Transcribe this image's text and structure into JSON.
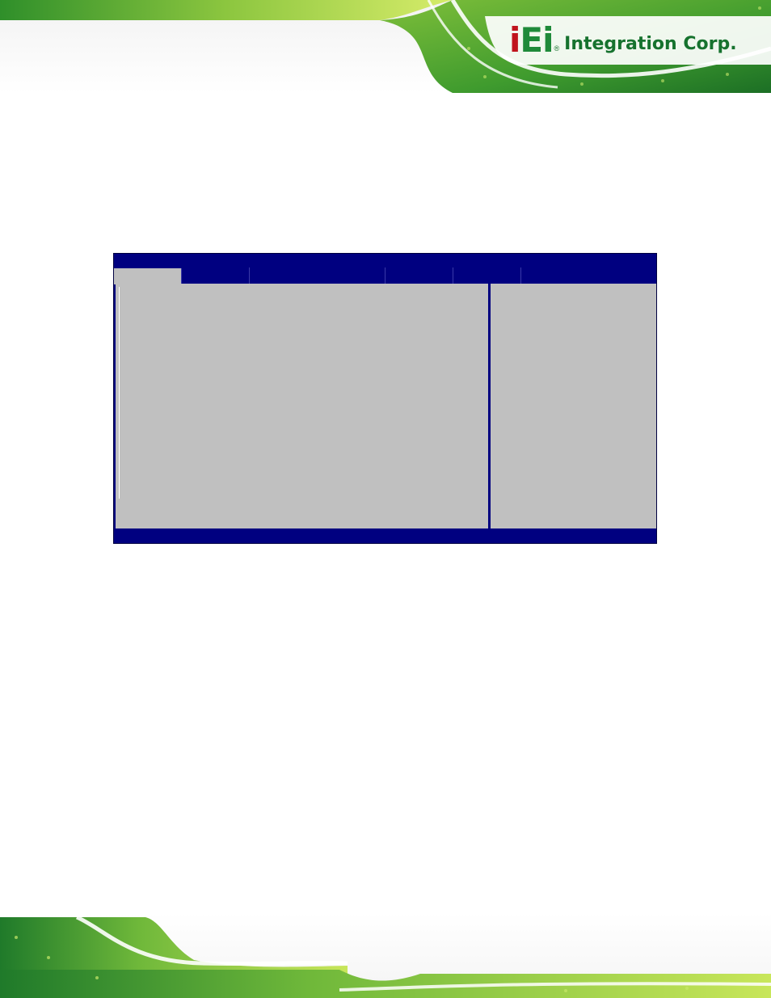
{
  "header": {
    "brand": {
      "mark_first": "i",
      "mark_rest": "Ei",
      "name": "Integration Corp.",
      "registered": "®"
    }
  },
  "bios": {
    "title": "",
    "tabs": [
      {
        "label": "",
        "active": true
      },
      {
        "label": "",
        "active": false
      },
      {
        "label": "",
        "active": false
      },
      {
        "label": "",
        "active": false
      },
      {
        "label": "",
        "active": false
      }
    ],
    "footer": ""
  },
  "colors": {
    "bios_blue": "#000080",
    "bios_gray": "#c0c0c0",
    "brand_green": "#1f8a3a",
    "brand_red": "#c0141d"
  }
}
